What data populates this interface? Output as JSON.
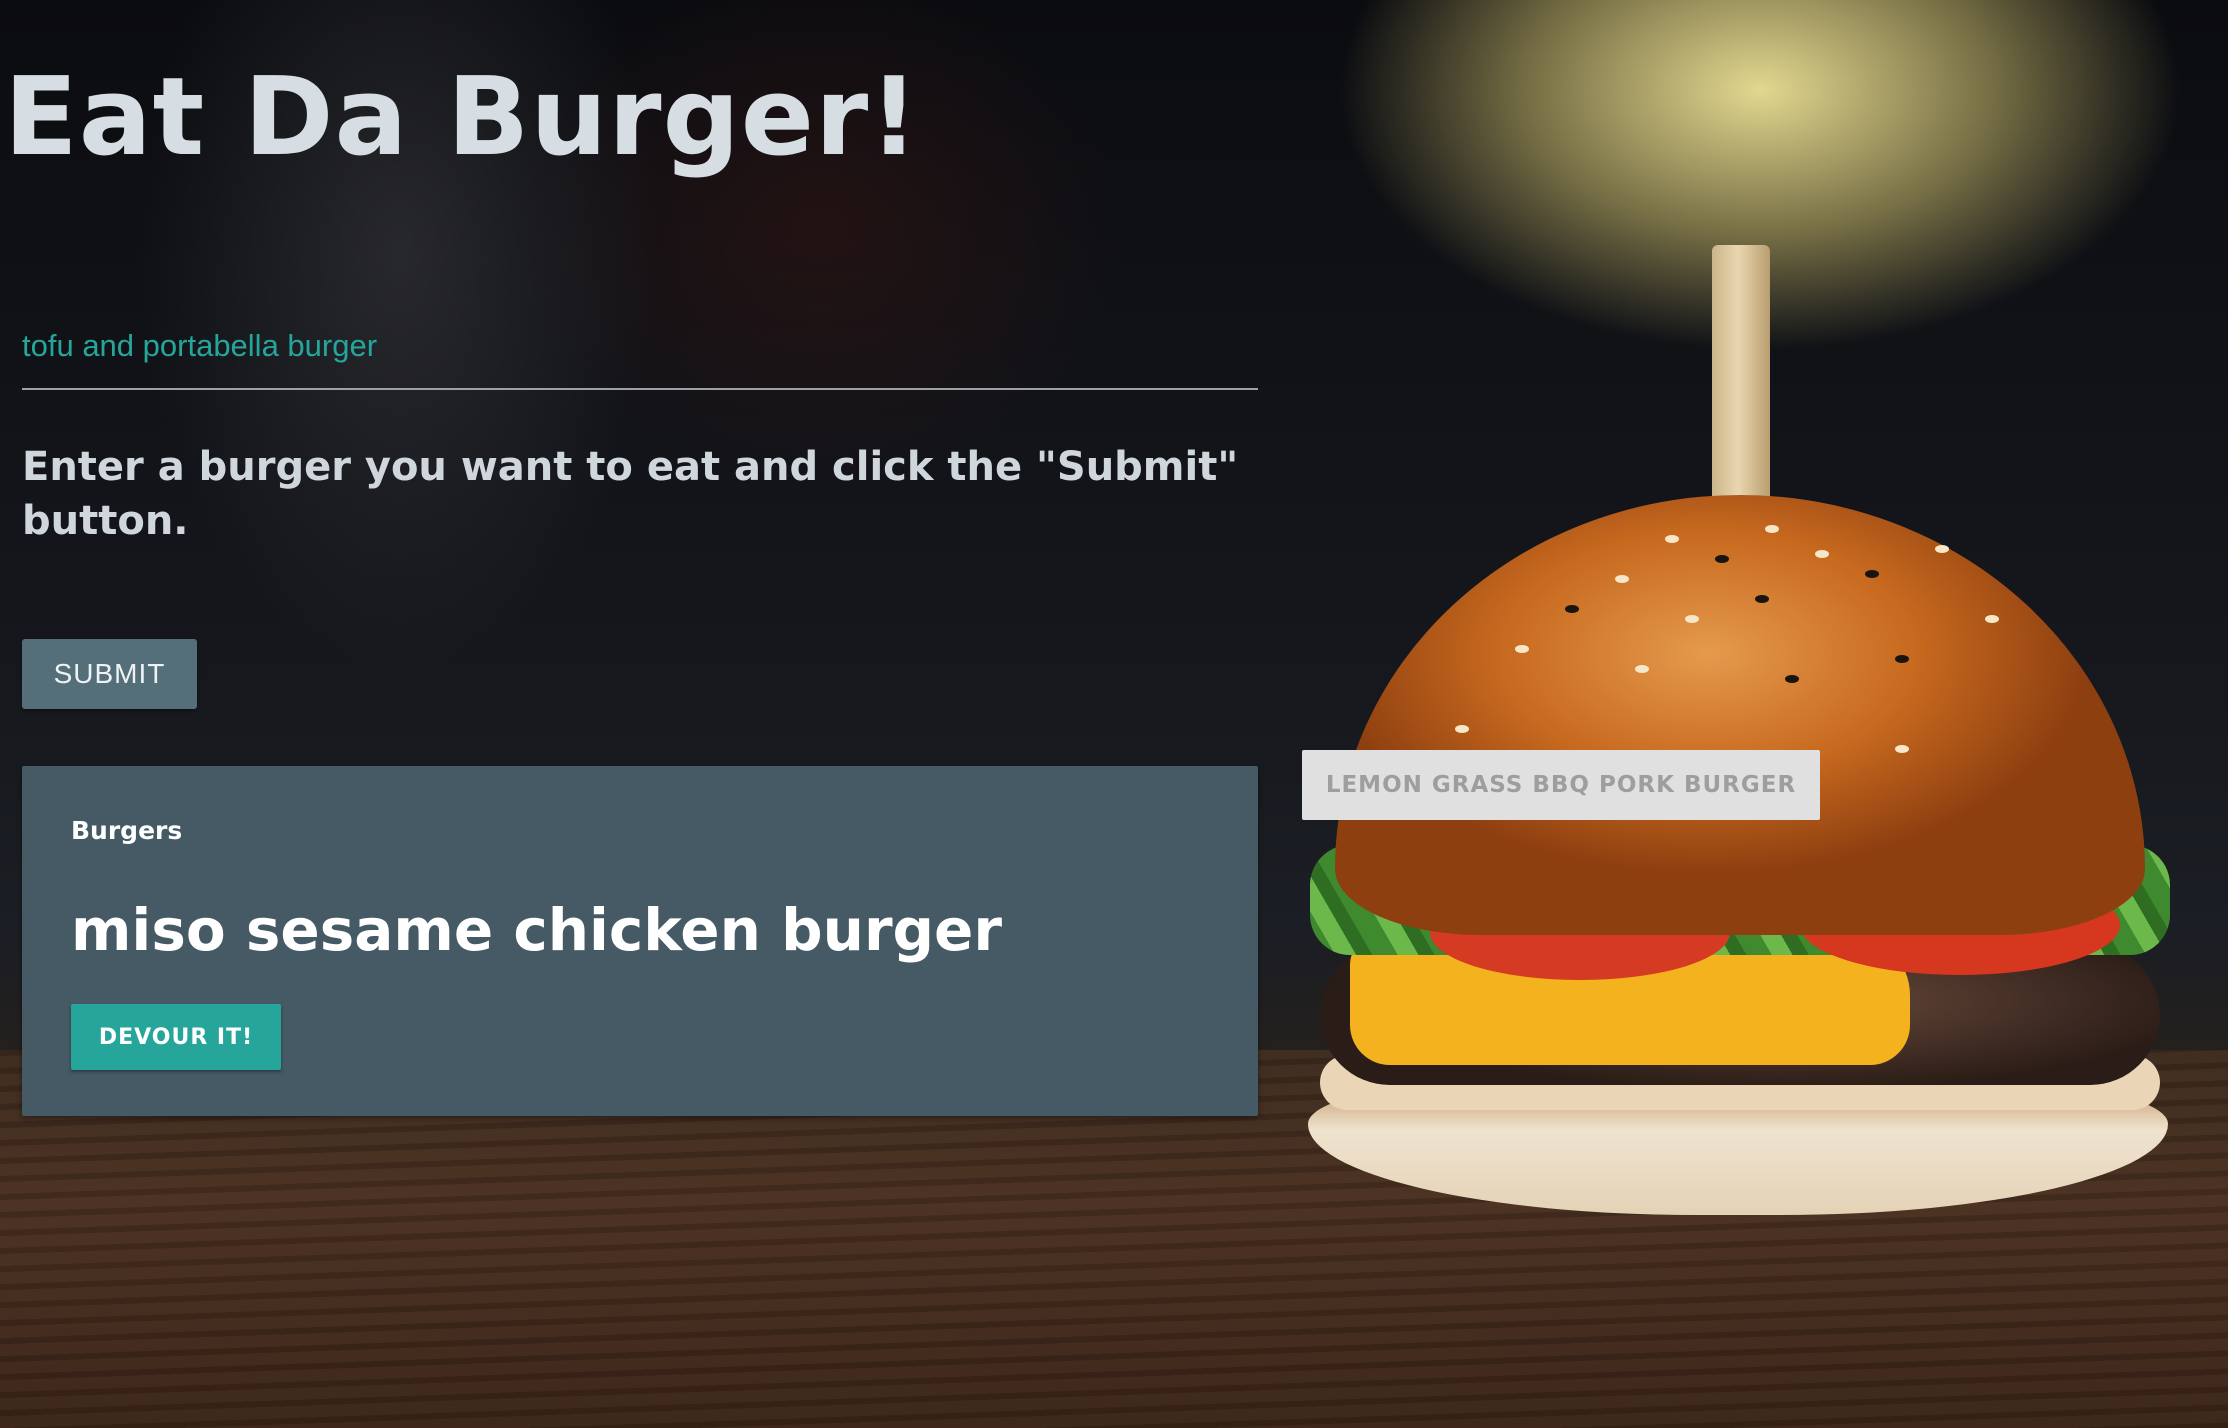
{
  "header": {
    "title": "Eat Da Burger!"
  },
  "form": {
    "input_value": "tofu and portabella burger",
    "instructions": "Enter a burger you want to eat and click the \"Submit\" button.",
    "submit_label": "SUBMIT"
  },
  "burgers_card": {
    "label": "Burgers",
    "items": [
      {
        "name": "miso sesame chicken burger",
        "action_label": "DEVOUR IT!"
      }
    ]
  },
  "devoured": {
    "items": [
      {
        "name": "LEMON GRASS BBQ PORK BURGER"
      }
    ]
  },
  "colors": {
    "accent": "#26a69a",
    "card_bg": "#455a64",
    "submit_bg": "#546e7a",
    "devoured_bg": "#e0e0e0"
  }
}
